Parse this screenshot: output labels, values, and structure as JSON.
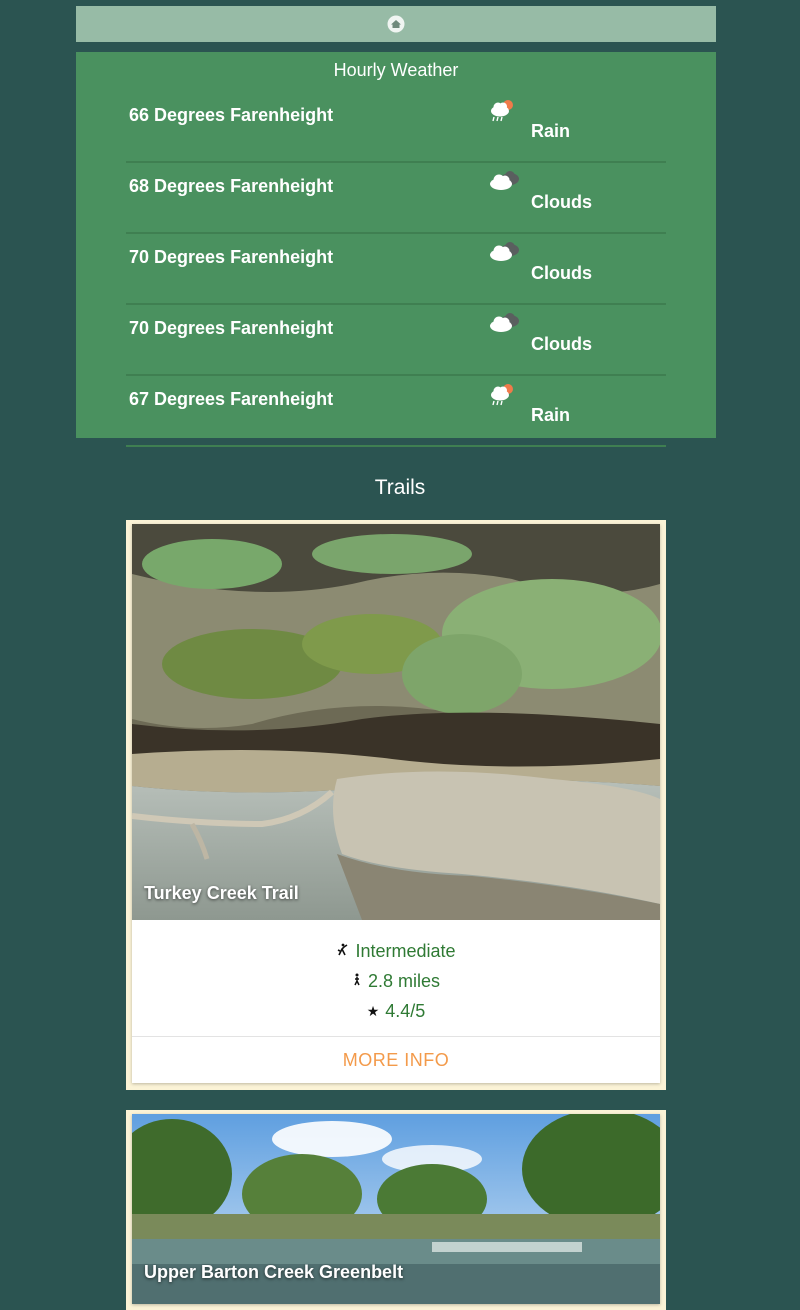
{
  "header": {
    "home_icon": "home-icon"
  },
  "weather": {
    "title": "Hourly Weather",
    "hours": [
      {
        "temp": "66 Degrees Farenheight",
        "condition": "Rain",
        "icon": "rain-cloud-icon"
      },
      {
        "temp": "68 Degrees Farenheight",
        "condition": "Clouds",
        "icon": "clouds-icon"
      },
      {
        "temp": "70 Degrees Farenheight",
        "condition": "Clouds",
        "icon": "clouds-icon"
      },
      {
        "temp": "70 Degrees Farenheight",
        "condition": "Clouds",
        "icon": "clouds-icon"
      },
      {
        "temp": "67 Degrees Farenheight",
        "condition": "Rain",
        "icon": "rain-cloud-icon"
      }
    ]
  },
  "trails": {
    "title": "Trails",
    "items": [
      {
        "name": "Turkey Creek Trail",
        "difficulty": "Intermediate",
        "length": "2.8 miles",
        "rating": "4.4/5",
        "action_label": "MORE INFO",
        "icons": {
          "difficulty": "climber-icon",
          "length": "hiker-icon",
          "rating": "star-icon"
        }
      },
      {
        "name": "Upper Barton Creek Greenbelt"
      }
    ]
  },
  "colors": {
    "background": "#2b5451",
    "header_bar": "#97bba6",
    "weather_panel": "#4a915f",
    "card_border": "#fbf3d6",
    "info_text": "#2f7a34",
    "action_text": "#f39a4a"
  }
}
